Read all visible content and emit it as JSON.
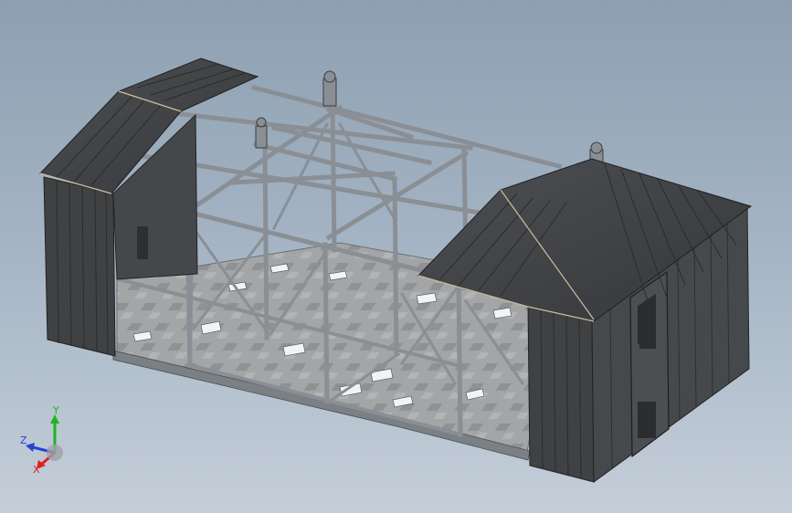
{
  "viewport": {
    "background_top": "#8d9fb1",
    "background_bottom": "#c4ced9"
  },
  "model": {
    "panel_color": "#3f4143",
    "frame_color": "#8a8f95",
    "floor_color": "#9a9c9e"
  },
  "triad": {
    "x_label": "X",
    "y_label": "Y",
    "z_label": "Z",
    "x_color": "#e02020",
    "y_color": "#1fb51f",
    "z_color": "#2a3fd8"
  }
}
